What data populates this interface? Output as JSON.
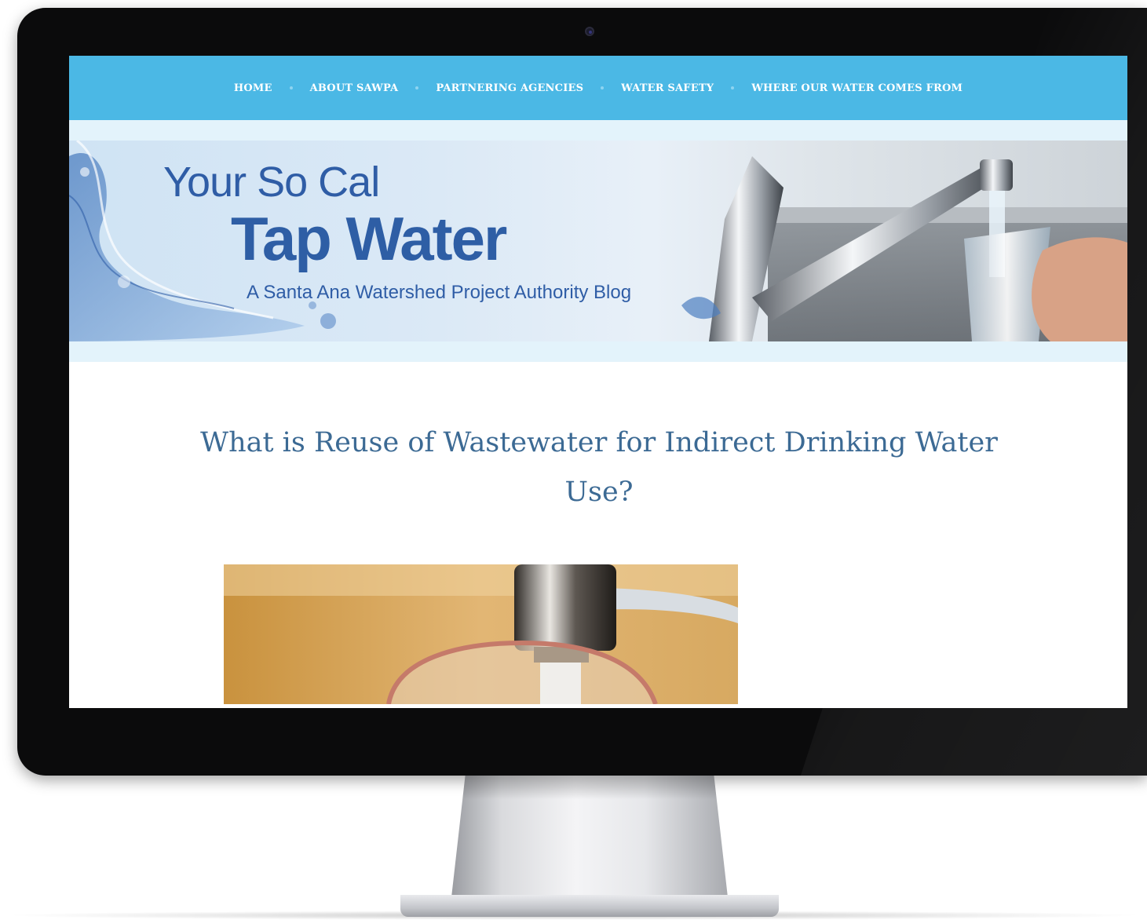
{
  "nav": {
    "items": [
      {
        "label": "HOME"
      },
      {
        "label": "ABOUT SAWPA"
      },
      {
        "label": "PARTNERING AGENCIES"
      },
      {
        "label": "WATER SAFETY"
      },
      {
        "label": "WHERE OUR WATER COMES FROM"
      }
    ]
  },
  "banner": {
    "line1": "Your So Cal",
    "line2": "Tap Water",
    "tagline": "A Santa Ana Watershed Project Authority Blog"
  },
  "article": {
    "title": "What is Reuse of Wastewater for Indirect Drinking Water Use?"
  },
  "colors": {
    "nav_bg": "#4bb8e5",
    "title_blue": "#2e5ea5",
    "article_title": "#3c6a94",
    "bezel": "#0b0b0c"
  },
  "icons": {
    "camera": "camera-icon",
    "separator": "dot-separator-icon"
  }
}
